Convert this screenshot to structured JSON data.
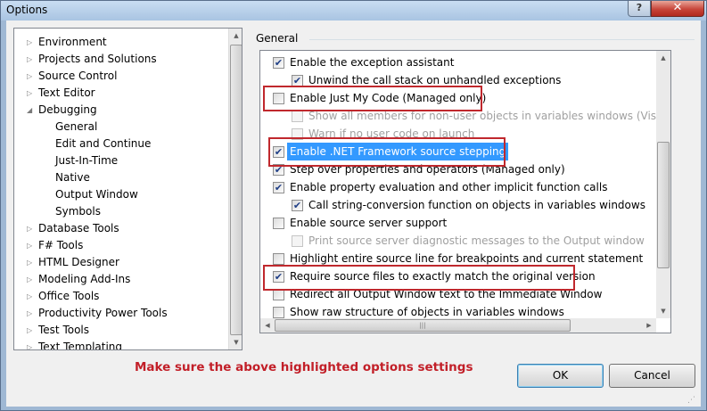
{
  "window": {
    "title": "Options",
    "help_label": "?",
    "close_label": "✕"
  },
  "tree": {
    "items": [
      {
        "label": "Environment",
        "expander": "▷",
        "level": 0
      },
      {
        "label": "Projects and Solutions",
        "expander": "▷",
        "level": 0
      },
      {
        "label": "Source Control",
        "expander": "▷",
        "level": 0
      },
      {
        "label": "Text Editor",
        "expander": "▷",
        "level": 0
      },
      {
        "label": "Debugging",
        "expander": "◢",
        "level": 0
      },
      {
        "label": "General",
        "expander": "",
        "level": 1,
        "selected": true
      },
      {
        "label": "Edit and Continue",
        "expander": "",
        "level": 1
      },
      {
        "label": "Just-In-Time",
        "expander": "",
        "level": 1
      },
      {
        "label": "Native",
        "expander": "",
        "level": 1
      },
      {
        "label": "Output Window",
        "expander": "",
        "level": 1
      },
      {
        "label": "Symbols",
        "expander": "",
        "level": 1
      },
      {
        "label": "Database Tools",
        "expander": "▷",
        "level": 0
      },
      {
        "label": "F# Tools",
        "expander": "▷",
        "level": 0
      },
      {
        "label": "HTML Designer",
        "expander": "▷",
        "level": 0
      },
      {
        "label": "Modeling Add-Ins",
        "expander": "▷",
        "level": 0
      },
      {
        "label": "Office Tools",
        "expander": "▷",
        "level": 0
      },
      {
        "label": "Productivity Power Tools",
        "expander": "▷",
        "level": 0
      },
      {
        "label": "Test Tools",
        "expander": "▷",
        "level": 0
      },
      {
        "label": "Text Templating",
        "expander": "▷",
        "level": 0
      }
    ],
    "scroll_up": "▲",
    "scroll_down": "▼"
  },
  "general": {
    "group_label": "General",
    "options": [
      {
        "label": "Enable the exception assistant",
        "checked": true,
        "indent": 0,
        "disabled": false
      },
      {
        "label": "Unwind the call stack on unhandled exceptions",
        "checked": true,
        "indent": 1,
        "disabled": false
      },
      {
        "label": "Enable Just My Code (Managed only)",
        "checked": false,
        "indent": 0,
        "disabled": false
      },
      {
        "label": "Show all members for non-user objects in variables windows (Visual Ba",
        "checked": false,
        "indent": 1,
        "disabled": true
      },
      {
        "label": "Warn if no user code on launch",
        "checked": false,
        "indent": 1,
        "disabled": true
      },
      {
        "label": "Enable .NET Framework source stepping",
        "checked": true,
        "indent": 0,
        "disabled": false,
        "selected": true
      },
      {
        "label": "Step over properties and operators (Managed only)",
        "checked": true,
        "indent": 0,
        "disabled": false
      },
      {
        "label": "Enable property evaluation and other implicit function calls",
        "checked": true,
        "indent": 0,
        "disabled": false
      },
      {
        "label": "Call string-conversion function on objects in variables windows",
        "checked": true,
        "indent": 1,
        "disabled": false
      },
      {
        "label": "Enable source server support",
        "checked": false,
        "indent": 0,
        "disabled": false
      },
      {
        "label": "Print source server diagnostic messages to the Output window",
        "checked": false,
        "indent": 1,
        "disabled": true
      },
      {
        "label": "Highlight entire source line for breakpoints and current statement",
        "checked": false,
        "indent": 0,
        "disabled": false
      },
      {
        "label": "Require source files to exactly match the original version",
        "checked": true,
        "indent": 0,
        "disabled": false
      },
      {
        "label": "Redirect all Output Window text to the Immediate Window",
        "checked": false,
        "indent": 0,
        "disabled": false
      },
      {
        "label": "Show raw structure of objects in variables windows",
        "checked": false,
        "indent": 0,
        "disabled": false
      }
    ],
    "checkmark": "✔",
    "scroll_up": "▲",
    "scroll_down": "▼",
    "scroll_left": "◀",
    "scroll_right": "▶",
    "thumb_grip": "|||"
  },
  "annotation": {
    "note": "Make sure the above highlighted options settings",
    "highlight_color": "#c0282d"
  },
  "buttons": {
    "ok": "OK",
    "cancel": "Cancel"
  },
  "grip_glyph": "⋰"
}
